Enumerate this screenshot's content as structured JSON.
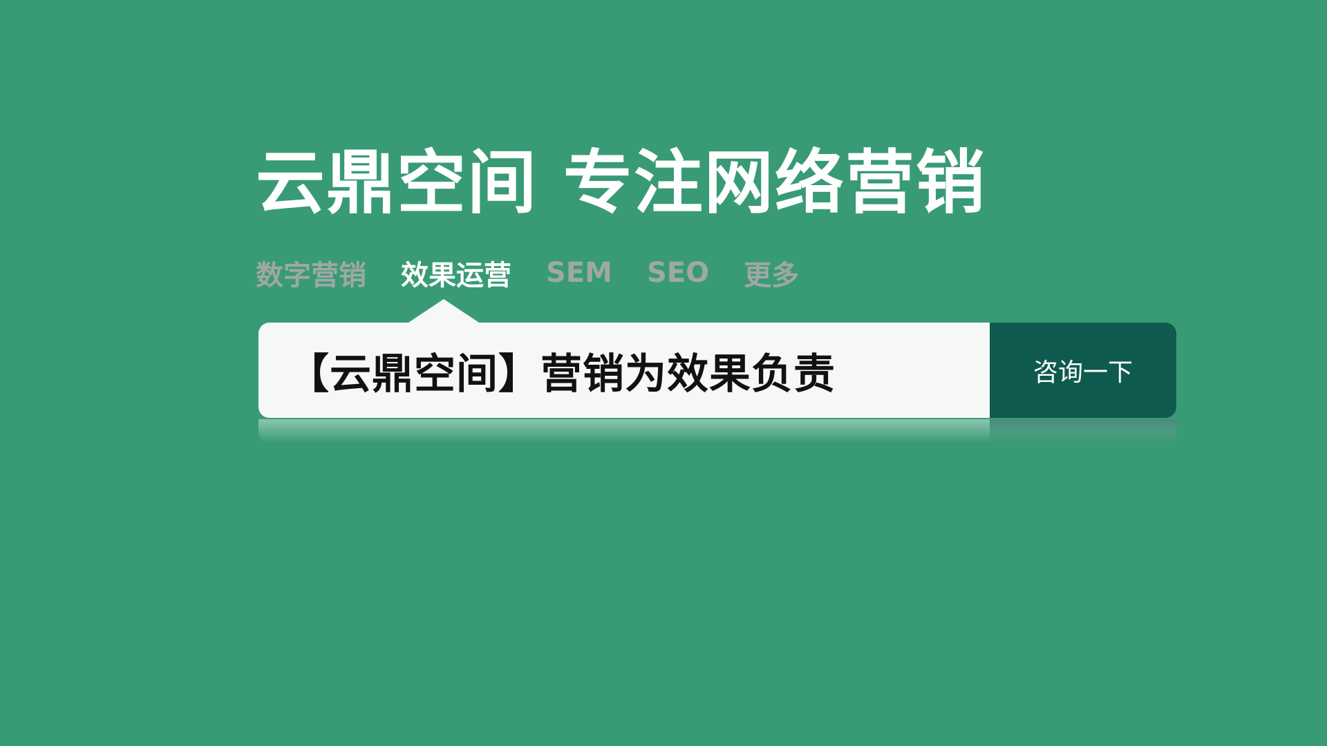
{
  "headline": "云鼎空间 专注网络营销",
  "tabs": [
    {
      "label": "数字营销",
      "active": false
    },
    {
      "label": "效果运营",
      "active": true
    },
    {
      "label": "SEM",
      "active": false
    },
    {
      "label": "SEO",
      "active": false
    },
    {
      "label": "更多",
      "active": false
    }
  ],
  "search": {
    "value": "【云鼎空间】营销为效果负责"
  },
  "consult_button_label": "咨询一下",
  "colors": {
    "background": "#389b76",
    "button": "#0f5a4e",
    "active_tab": "#ffffff",
    "inactive_tab": "#9fa8a4"
  }
}
